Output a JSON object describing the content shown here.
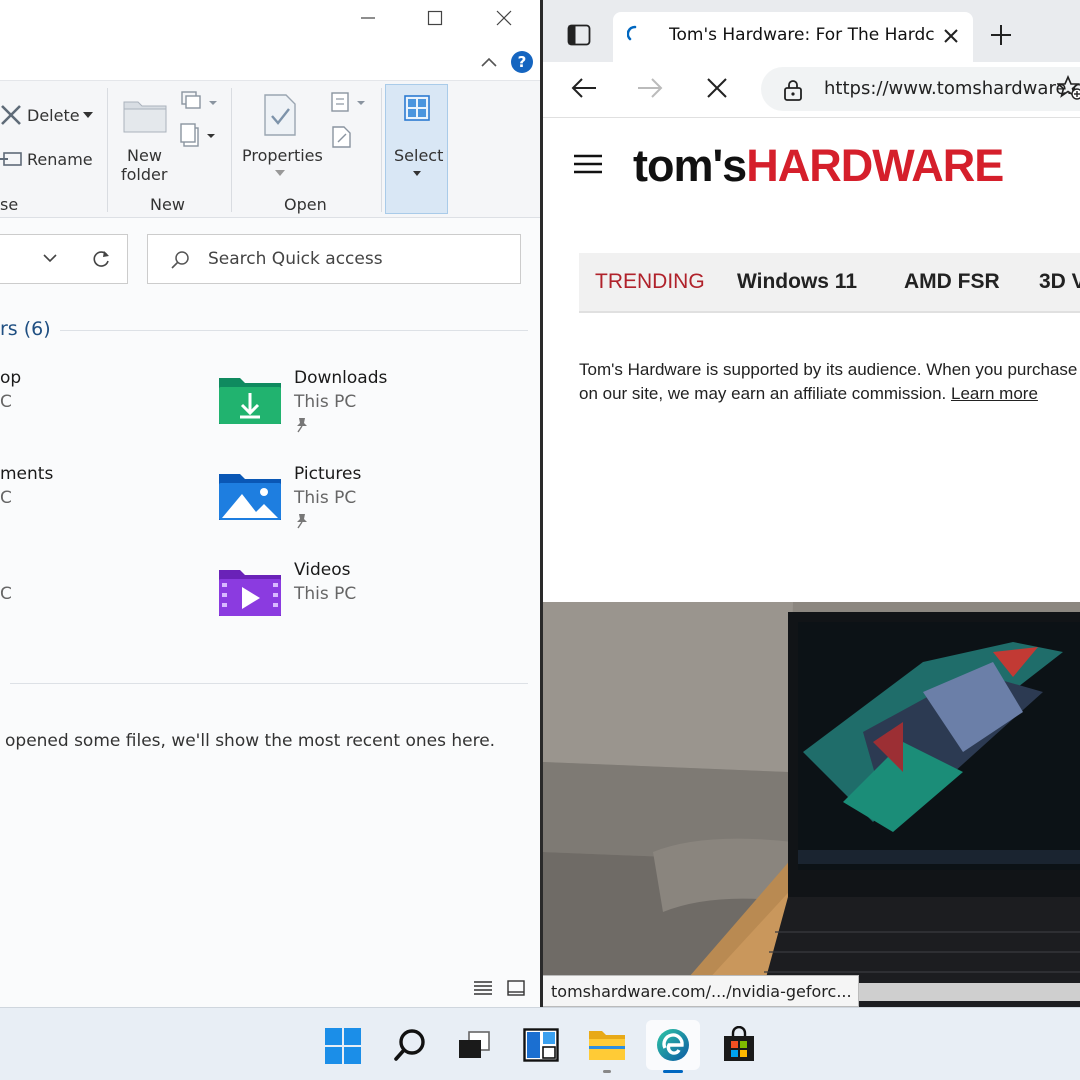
{
  "explorer": {
    "ribbon": {
      "delete_label": "Delete",
      "rename_label": "Rename",
      "new_folder_line1": "New",
      "new_folder_line2": "folder",
      "properties_label": "Properties",
      "select_label": "Select",
      "group_organize": "se",
      "group_new": "New",
      "group_open": "Open"
    },
    "search_placeholder": "Search Quick access",
    "section_title": "rs (6)",
    "folders": [
      {
        "name": "op",
        "location": "C"
      },
      {
        "name": "Downloads",
        "location": "This PC"
      },
      {
        "name": "ments",
        "location": "C"
      },
      {
        "name": "Pictures",
        "location": "This PC"
      },
      {
        "name": "",
        "location": "C"
      },
      {
        "name": "Videos",
        "location": "This PC"
      }
    ],
    "recent_message": "opened some files, we'll show the most recent ones here."
  },
  "browser": {
    "tab_title": "Tom's Hardware: For The Hardcore",
    "url": "https://www.tomshardware.com/",
    "logo_part1": "tom's",
    "logo_part2": "HARDWARE",
    "trending_label": "TRENDING",
    "trending_items": [
      "Windows 11",
      "AMD FSR",
      "3D V"
    ],
    "support_text": "Tom's Hardware is supported by its audience. When you purchase through links on our site, we may earn an affiliate commission.",
    "learn_more": "Learn more",
    "status_url": "tomshardware.com/.../nvidia-geforc..."
  },
  "colors": {
    "accent": "#0067c0",
    "brand_red": "#d51f2b",
    "trending_red": "#b0222b"
  }
}
